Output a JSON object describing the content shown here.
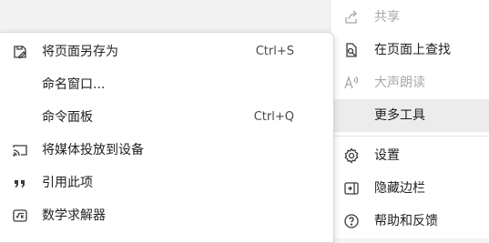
{
  "main_menu": {
    "share": {
      "label": "共享",
      "icon": "share-icon"
    },
    "find_on_page": {
      "label": "在页面上查找",
      "icon": "find-icon"
    },
    "read_aloud": {
      "label": "大声朗读",
      "icon": "read-aloud-icon"
    },
    "more_tools": {
      "label": "更多工具"
    },
    "settings": {
      "label": "设置",
      "icon": "gear-icon"
    },
    "hide_sidebar": {
      "label": "隐藏边栏",
      "icon": "sidebar-icon"
    },
    "help_feedback": {
      "label": "帮助和反馈",
      "icon": "help-icon"
    }
  },
  "more_tools_submenu": {
    "save_page_as": {
      "label": "将页面另存为",
      "shortcut": "Ctrl+S",
      "icon": "save-page-icon"
    },
    "name_window": {
      "label": "命名窗口..."
    },
    "command_palette": {
      "label": "命令面板",
      "shortcut": "Ctrl+Q"
    },
    "cast_media": {
      "label": "将媒体投放到设备",
      "icon": "cast-icon"
    },
    "cite_this": {
      "label": "引用此项",
      "icon": "quote-icon"
    },
    "math_solver": {
      "label": "数学求解器",
      "icon": "math-solver-icon"
    }
  },
  "colors": {
    "menu_bg": "#ffffff",
    "selected_bg": "#ececec",
    "disabled_text": "#a8a8a8"
  }
}
